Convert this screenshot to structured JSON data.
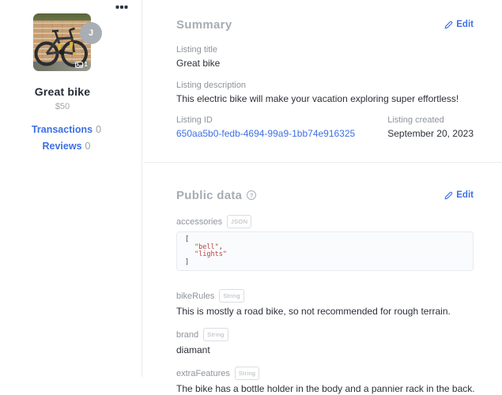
{
  "sidebar": {
    "avatar_initial": "J",
    "photo_count": "1",
    "title": "Great bike",
    "price": "$50",
    "transactions": {
      "label": "Transactions",
      "count": "0"
    },
    "reviews": {
      "label": "Reviews",
      "count": "0"
    }
  },
  "summary": {
    "heading": "Summary",
    "edit_label": "Edit",
    "listing_title": {
      "label": "Listing title",
      "value": "Great bike"
    },
    "listing_description": {
      "label": "Listing description",
      "value": "This electric bike will make your vacation exploring super effortless!"
    },
    "listing_id": {
      "label": "Listing ID",
      "value": "650aa5b0-fedb-4694-99a9-1bb74e916325"
    },
    "listing_created": {
      "label": "Listing created",
      "value": "September 20, 2023"
    }
  },
  "public_data": {
    "heading": "Public data",
    "help_icon": "?",
    "edit_label": "Edit",
    "accessories": {
      "key": "accessories",
      "type_badge": "JSON",
      "json": {
        "open": "[",
        "item1": "\"bell\"",
        "comma": ",",
        "item2": "\"lights\"",
        "close": "]"
      }
    },
    "bike_rules": {
      "key": "bikeRules",
      "type_badge": "String",
      "value": "This is mostly a road bike, so not recommended for rough terrain."
    },
    "brand": {
      "key": "brand",
      "type_badge": "String",
      "value": "diamant"
    },
    "extra_features": {
      "key": "extraFeatures",
      "type_badge": "String",
      "value": "The bike has a bottle holder in the body and a pannier rack in the back."
    }
  },
  "colors": {
    "link_blue": "#3d6fe5",
    "heading_gray": "#a7adb5",
    "label_gray": "#8e949c",
    "text_dark": "#2c3038",
    "json_string_red": "#b5433e"
  }
}
